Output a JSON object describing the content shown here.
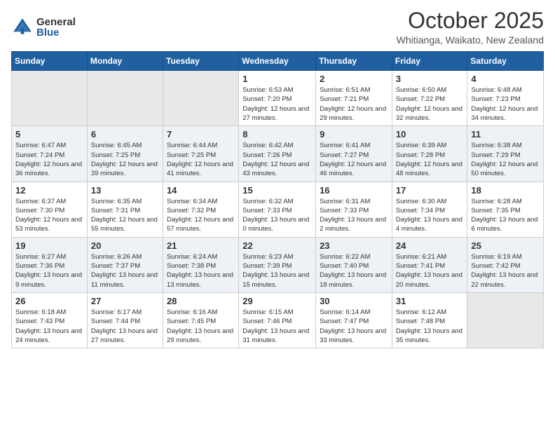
{
  "header": {
    "logo_general": "General",
    "logo_blue": "Blue",
    "month": "October 2025",
    "location": "Whitianga, Waikato, New Zealand"
  },
  "weekdays": [
    "Sunday",
    "Monday",
    "Tuesday",
    "Wednesday",
    "Thursday",
    "Friday",
    "Saturday"
  ],
  "weeks": [
    [
      {
        "day": "",
        "sunrise": "",
        "sunset": "",
        "daylight": ""
      },
      {
        "day": "",
        "sunrise": "",
        "sunset": "",
        "daylight": ""
      },
      {
        "day": "",
        "sunrise": "",
        "sunset": "",
        "daylight": ""
      },
      {
        "day": "1",
        "sunrise": "Sunrise: 6:53 AM",
        "sunset": "Sunset: 7:20 PM",
        "daylight": "Daylight: 12 hours and 27 minutes."
      },
      {
        "day": "2",
        "sunrise": "Sunrise: 6:51 AM",
        "sunset": "Sunset: 7:21 PM",
        "daylight": "Daylight: 12 hours and 29 minutes."
      },
      {
        "day": "3",
        "sunrise": "Sunrise: 6:50 AM",
        "sunset": "Sunset: 7:22 PM",
        "daylight": "Daylight: 12 hours and 32 minutes."
      },
      {
        "day": "4",
        "sunrise": "Sunrise: 6:48 AM",
        "sunset": "Sunset: 7:23 PM",
        "daylight": "Daylight: 12 hours and 34 minutes."
      }
    ],
    [
      {
        "day": "5",
        "sunrise": "Sunrise: 6:47 AM",
        "sunset": "Sunset: 7:24 PM",
        "daylight": "Daylight: 12 hours and 36 minutes."
      },
      {
        "day": "6",
        "sunrise": "Sunrise: 6:45 AM",
        "sunset": "Sunset: 7:25 PM",
        "daylight": "Daylight: 12 hours and 39 minutes."
      },
      {
        "day": "7",
        "sunrise": "Sunrise: 6:44 AM",
        "sunset": "Sunset: 7:25 PM",
        "daylight": "Daylight: 12 hours and 41 minutes."
      },
      {
        "day": "8",
        "sunrise": "Sunrise: 6:42 AM",
        "sunset": "Sunset: 7:26 PM",
        "daylight": "Daylight: 12 hours and 43 minutes."
      },
      {
        "day": "9",
        "sunrise": "Sunrise: 6:41 AM",
        "sunset": "Sunset: 7:27 PM",
        "daylight": "Daylight: 12 hours and 46 minutes."
      },
      {
        "day": "10",
        "sunrise": "Sunrise: 6:39 AM",
        "sunset": "Sunset: 7:28 PM",
        "daylight": "Daylight: 12 hours and 48 minutes."
      },
      {
        "day": "11",
        "sunrise": "Sunrise: 6:38 AM",
        "sunset": "Sunset: 7:29 PM",
        "daylight": "Daylight: 12 hours and 50 minutes."
      }
    ],
    [
      {
        "day": "12",
        "sunrise": "Sunrise: 6:37 AM",
        "sunset": "Sunset: 7:30 PM",
        "daylight": "Daylight: 12 hours and 53 minutes."
      },
      {
        "day": "13",
        "sunrise": "Sunrise: 6:35 AM",
        "sunset": "Sunset: 7:31 PM",
        "daylight": "Daylight: 12 hours and 55 minutes."
      },
      {
        "day": "14",
        "sunrise": "Sunrise: 6:34 AM",
        "sunset": "Sunset: 7:32 PM",
        "daylight": "Daylight: 12 hours and 57 minutes."
      },
      {
        "day": "15",
        "sunrise": "Sunrise: 6:32 AM",
        "sunset": "Sunset: 7:33 PM",
        "daylight": "Daylight: 13 hours and 0 minutes."
      },
      {
        "day": "16",
        "sunrise": "Sunrise: 6:31 AM",
        "sunset": "Sunset: 7:33 PM",
        "daylight": "Daylight: 13 hours and 2 minutes."
      },
      {
        "day": "17",
        "sunrise": "Sunrise: 6:30 AM",
        "sunset": "Sunset: 7:34 PM",
        "daylight": "Daylight: 13 hours and 4 minutes."
      },
      {
        "day": "18",
        "sunrise": "Sunrise: 6:28 AM",
        "sunset": "Sunset: 7:35 PM",
        "daylight": "Daylight: 13 hours and 6 minutes."
      }
    ],
    [
      {
        "day": "19",
        "sunrise": "Sunrise: 6:27 AM",
        "sunset": "Sunset: 7:36 PM",
        "daylight": "Daylight: 13 hours and 9 minutes."
      },
      {
        "day": "20",
        "sunrise": "Sunrise: 6:26 AM",
        "sunset": "Sunset: 7:37 PM",
        "daylight": "Daylight: 13 hours and 11 minutes."
      },
      {
        "day": "21",
        "sunrise": "Sunrise: 6:24 AM",
        "sunset": "Sunset: 7:38 PM",
        "daylight": "Daylight: 13 hours and 13 minutes."
      },
      {
        "day": "22",
        "sunrise": "Sunrise: 6:23 AM",
        "sunset": "Sunset: 7:39 PM",
        "daylight": "Daylight: 13 hours and 15 minutes."
      },
      {
        "day": "23",
        "sunrise": "Sunrise: 6:22 AM",
        "sunset": "Sunset: 7:40 PM",
        "daylight": "Daylight: 13 hours and 18 minutes."
      },
      {
        "day": "24",
        "sunrise": "Sunrise: 6:21 AM",
        "sunset": "Sunset: 7:41 PM",
        "daylight": "Daylight: 13 hours and 20 minutes."
      },
      {
        "day": "25",
        "sunrise": "Sunrise: 6:19 AM",
        "sunset": "Sunset: 7:42 PM",
        "daylight": "Daylight: 13 hours and 22 minutes."
      }
    ],
    [
      {
        "day": "26",
        "sunrise": "Sunrise: 6:18 AM",
        "sunset": "Sunset: 7:43 PM",
        "daylight": "Daylight: 13 hours and 24 minutes."
      },
      {
        "day": "27",
        "sunrise": "Sunrise: 6:17 AM",
        "sunset": "Sunset: 7:44 PM",
        "daylight": "Daylight: 13 hours and 27 minutes."
      },
      {
        "day": "28",
        "sunrise": "Sunrise: 6:16 AM",
        "sunset": "Sunset: 7:45 PM",
        "daylight": "Daylight: 13 hours and 29 minutes."
      },
      {
        "day": "29",
        "sunrise": "Sunrise: 6:15 AM",
        "sunset": "Sunset: 7:46 PM",
        "daylight": "Daylight: 13 hours and 31 minutes."
      },
      {
        "day": "30",
        "sunrise": "Sunrise: 6:14 AM",
        "sunset": "Sunset: 7:47 PM",
        "daylight": "Daylight: 13 hours and 33 minutes."
      },
      {
        "day": "31",
        "sunrise": "Sunrise: 6:12 AM",
        "sunset": "Sunset: 7:48 PM",
        "daylight": "Daylight: 13 hours and 35 minutes."
      },
      {
        "day": "",
        "sunrise": "",
        "sunset": "",
        "daylight": ""
      }
    ]
  ]
}
